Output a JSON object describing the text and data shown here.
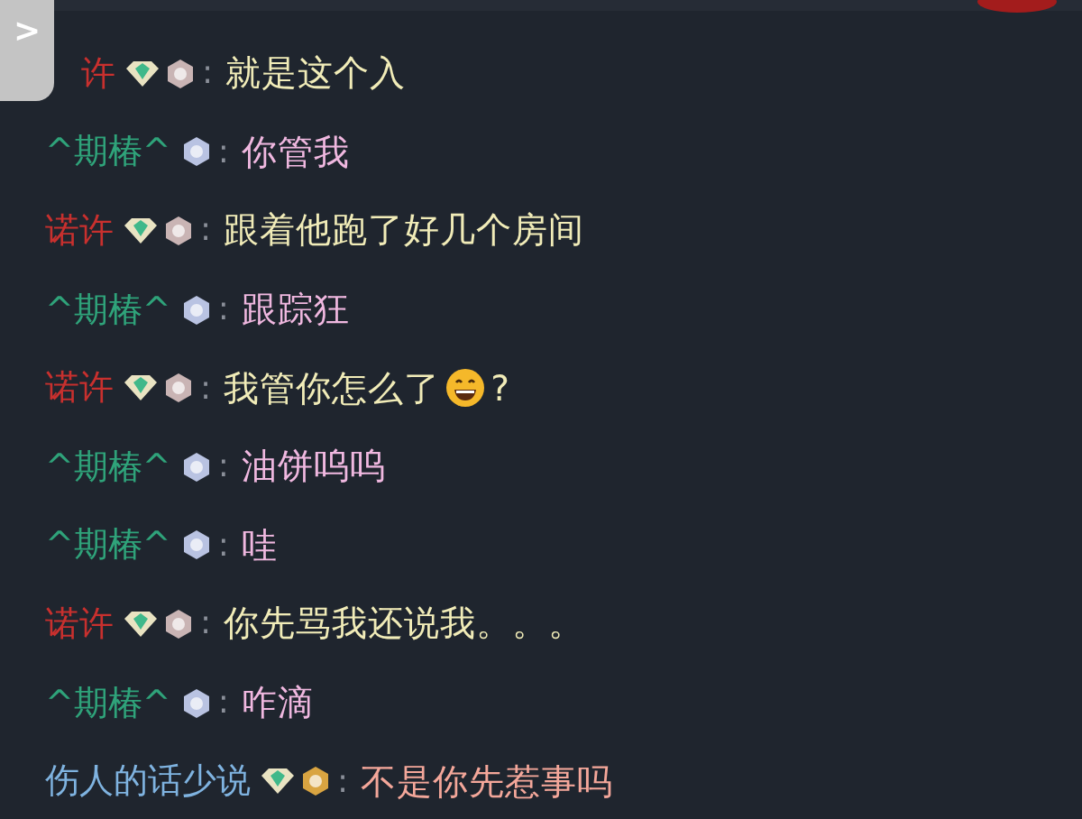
{
  "side_tab": {
    "icon": ">"
  },
  "messages": [
    {
      "kind": "red",
      "name": "许",
      "badges": [
        {
          "kind": "diamond"
        },
        {
          "kind": "medal",
          "color": "#c9b4b4"
        }
      ],
      "separator": ":",
      "parts": [
        {
          "kind": "text",
          "text": "就是这个入"
        }
      ]
    },
    {
      "kind": "green",
      "name": "^期椿^",
      "badges": [
        {
          "kind": "medal",
          "color": "#b9c3e2"
        }
      ],
      "separator": ":",
      "parts": [
        {
          "kind": "text",
          "text": "你管我"
        }
      ]
    },
    {
      "kind": "red",
      "name": "诺许",
      "badges": [
        {
          "kind": "diamond"
        },
        {
          "kind": "medal",
          "color": "#c9b4b4"
        }
      ],
      "separator": ":",
      "parts": [
        {
          "kind": "text",
          "text": "跟着他跑了好几个房间"
        }
      ]
    },
    {
      "kind": "green",
      "name": "^期椿^",
      "badges": [
        {
          "kind": "medal",
          "color": "#b9c3e2"
        }
      ],
      "separator": ":",
      "parts": [
        {
          "kind": "text",
          "text": "跟踪狂"
        }
      ]
    },
    {
      "kind": "red",
      "name": "诺许",
      "badges": [
        {
          "kind": "diamond"
        },
        {
          "kind": "medal",
          "color": "#c9b4b4"
        }
      ],
      "separator": ":",
      "parts": [
        {
          "kind": "text",
          "text": "我管你怎么了"
        },
        {
          "kind": "emoji"
        },
        {
          "kind": "text",
          "text": "?"
        }
      ]
    },
    {
      "kind": "green",
      "name": "^期椿^",
      "badges": [
        {
          "kind": "medal",
          "color": "#b9c3e2"
        }
      ],
      "separator": ":",
      "parts": [
        {
          "kind": "text",
          "text": "油饼呜呜"
        }
      ]
    },
    {
      "kind": "green",
      "name": "^期椿^",
      "badges": [
        {
          "kind": "medal",
          "color": "#b9c3e2"
        }
      ],
      "separator": ":",
      "parts": [
        {
          "kind": "text",
          "text": "哇"
        }
      ]
    },
    {
      "kind": "red",
      "name": "诺许",
      "badges": [
        {
          "kind": "diamond"
        },
        {
          "kind": "medal",
          "color": "#c9b4b4"
        }
      ],
      "separator": ":",
      "parts": [
        {
          "kind": "text",
          "text": "你先骂我还说我。。。"
        }
      ]
    },
    {
      "kind": "green",
      "name": "^期椿^",
      "badges": [
        {
          "kind": "medal",
          "color": "#b9c3e2"
        }
      ],
      "separator": ":",
      "parts": [
        {
          "kind": "text",
          "text": "咋滴"
        }
      ]
    },
    {
      "kind": "blue",
      "name": "伤人的话少说",
      "badges": [
        {
          "kind": "diamond"
        },
        {
          "kind": "medal",
          "color": "#d9a441"
        }
      ],
      "separator": ":",
      "parts": [
        {
          "kind": "text",
          "text": "不是你先惹事吗"
        }
      ]
    }
  ]
}
